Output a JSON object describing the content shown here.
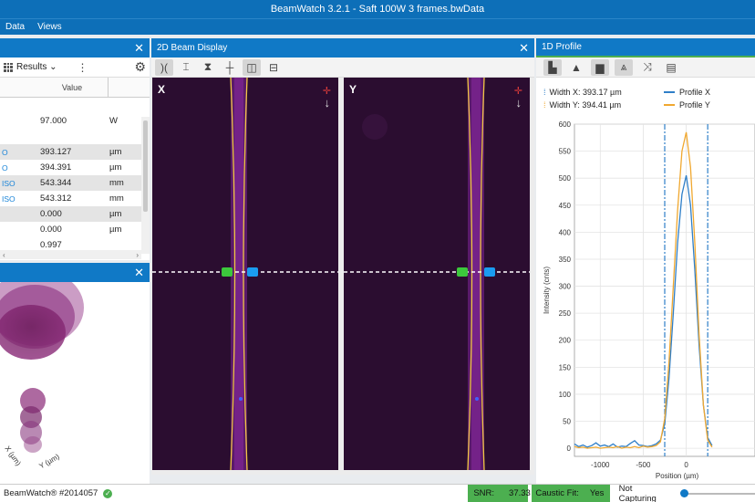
{
  "window": {
    "title": "BeamWatch 3.2.1 - Saft 100W 3 frames.bwData"
  },
  "menu": {
    "items": [
      "Data",
      "Views"
    ]
  },
  "results_panel": {
    "dropdown_label": "Results",
    "columns": {
      "value": "Value"
    },
    "rows": [
      {
        "key": "",
        "value": "",
        "unit": ""
      },
      {
        "key": "",
        "value": "97.000",
        "unit": "W"
      },
      {
        "key": "",
        "value": "",
        "unit": ""
      },
      {
        "key": "O",
        "value": "393.127",
        "unit": "µm"
      },
      {
        "key": "O",
        "value": "394.391",
        "unit": "µm"
      },
      {
        "key": "ISO",
        "value": "543.344",
        "unit": "mm"
      },
      {
        "key": "ISO",
        "value": "543.312",
        "unit": "mm"
      },
      {
        "key": "",
        "value": "0.000",
        "unit": "µm"
      },
      {
        "key": "",
        "value": "0.000",
        "unit": "µm"
      },
      {
        "key": "",
        "value": "0.997",
        "unit": ""
      }
    ]
  },
  "caustic_panel": {
    "axis_x": "X (µm)",
    "axis_y": "Y (µm)",
    "axis_zero": "0"
  },
  "beam_panel": {
    "title": "2D Beam Display",
    "left_label": "X",
    "right_label": "Y"
  },
  "profile_panel": {
    "title": "1D Profile",
    "width_x": "Width X: 393.17 µm",
    "width_y": "Width Y: 394.41 µm",
    "legend_x": "Profile X",
    "legend_y": "Profile Y",
    "ylabel": "Intensity (cnts)",
    "xlabel": "Position (µm)",
    "colors": {
      "x": "#2f7fc8",
      "y": "#f0a830"
    }
  },
  "chart_data": {
    "type": "line",
    "title": "",
    "xlabel": "Position (µm)",
    "ylabel": "Intensity (cnts)",
    "xlim": [
      -1300,
      800
    ],
    "ylim": [
      -15,
      600
    ],
    "x_ticks": [
      -1000,
      -500,
      0
    ],
    "y_ticks": [
      0,
      50,
      100,
      150,
      200,
      250,
      300,
      350,
      400,
      450,
      500,
      550,
      600
    ],
    "series": [
      {
        "name": "Profile X",
        "x": [
          -1300,
          -1250,
          -1200,
          -1150,
          -1100,
          -1050,
          -1000,
          -950,
          -900,
          -850,
          -800,
          -750,
          -700,
          -650,
          -600,
          -550,
          -500,
          -450,
          -400,
          -350,
          -300,
          -250,
          -200,
          -150,
          -100,
          -50,
          0,
          50,
          100,
          150,
          200,
          250,
          300
        ],
        "values": [
          8,
          3,
          6,
          2,
          5,
          10,
          4,
          6,
          3,
          8,
          2,
          4,
          3,
          9,
          14,
          6,
          5,
          3,
          5,
          8,
          15,
          45,
          130,
          250,
          380,
          470,
          505,
          450,
          330,
          190,
          80,
          20,
          5
        ]
      },
      {
        "name": "Profile Y",
        "x": [
          -1300,
          -1250,
          -1200,
          -1150,
          -1100,
          -1050,
          -1000,
          -950,
          -900,
          -850,
          -800,
          -750,
          -700,
          -650,
          -600,
          -550,
          -500,
          -450,
          -400,
          -350,
          -300,
          -250,
          -200,
          -150,
          -100,
          -50,
          0,
          50,
          100,
          150,
          200,
          250,
          300
        ],
        "values": [
          3,
          1,
          2,
          0,
          1,
          2,
          0,
          1,
          2,
          1,
          3,
          0,
          2,
          1,
          3,
          1,
          4,
          2,
          3,
          5,
          12,
          55,
          160,
          300,
          440,
          550,
          585,
          520,
          380,
          210,
          80,
          15,
          2
        ]
      }
    ],
    "markers_x": [
      -250,
      250
    ]
  },
  "status": {
    "device": "BeamWatch® #2014057",
    "snr_label": "SNR:",
    "snr_value": "37.33",
    "fit_label": "Caustic Fit:",
    "fit_value": "Yes",
    "capture_state": "Not Capturing"
  }
}
